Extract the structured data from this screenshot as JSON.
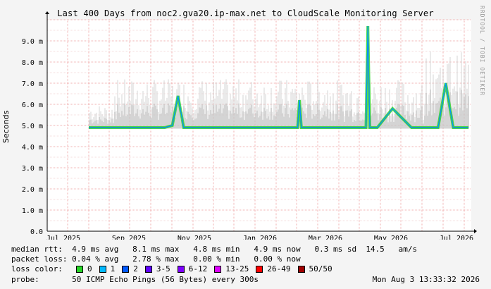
{
  "title": "Last 400 Days from noc2.gva20.ip-max.net to CloudScale Monitoring Server",
  "credit": "RRDTOOL / TOBI OETIKER",
  "chart_data": {
    "type": "line",
    "ylabel": "Seconds",
    "ylim": [
      0,
      10
    ],
    "y_ticks": [
      "0.0",
      "1.0 m",
      "2.0 m",
      "3.0 m",
      "4.0 m",
      "5.0 m",
      "6.0 m",
      "7.0 m",
      "8.0 m",
      "9.0 m"
    ],
    "x_ticks": [
      "Jul 2025",
      "Sep 2025",
      "Nov 2025",
      "Jan 2026",
      "Mar 2026",
      "May 2026",
      "Jul 2026"
    ],
    "grid": true,
    "series": [
      {
        "x": [
          0.0,
          0.05,
          0.1,
          0.15,
          0.2,
          0.22,
          0.235,
          0.25,
          0.3,
          0.35,
          0.4,
          0.45,
          0.5,
          0.55,
          0.555,
          0.56,
          0.6,
          0.65,
          0.7,
          0.73,
          0.735,
          0.74,
          0.75,
          0.76,
          0.8,
          0.85,
          0.9,
          0.92,
          0.94,
          0.96,
          1.0
        ],
        "values": [
          4.9,
          4.9,
          4.9,
          4.9,
          4.9,
          5.0,
          6.4,
          4.9,
          4.9,
          4.9,
          4.9,
          4.9,
          4.9,
          4.9,
          6.2,
          4.9,
          4.9,
          4.9,
          4.9,
          4.9,
          9.7,
          4.9,
          4.9,
          4.9,
          5.8,
          4.9,
          4.9,
          4.9,
          7.0,
          4.9,
          4.9
        ]
      }
    ]
  },
  "stats": {
    "median_rtt": "median rtt:  4.9 ms avg   8.1 ms max   4.8 ms min   4.9 ms now   0.3 ms sd  14.5   am/s",
    "packet_loss": "packet loss: 0.04 % avg   2.78 % max   0.00 % min   0.00 % now",
    "probe": "probe:       50 ICMP Echo Pings (56 Bytes) every 300s"
  },
  "legend": {
    "label": "loss color:",
    "items": [
      {
        "label": "0",
        "color": "#26d526"
      },
      {
        "label": "1",
        "color": "#00b8ff"
      },
      {
        "label": "2",
        "color": "#0059ff"
      },
      {
        "label": "3-5",
        "color": "#5e00ff"
      },
      {
        "label": "6-12",
        "color": "#7e00ff"
      },
      {
        "label": "13-25",
        "color": "#dd00ff"
      },
      {
        "label": "26-49",
        "color": "#ff0000"
      },
      {
        "label": "50/50",
        "color": "#a00000"
      }
    ]
  },
  "timestamp": "Mon Aug  3 13:33:32 2026"
}
